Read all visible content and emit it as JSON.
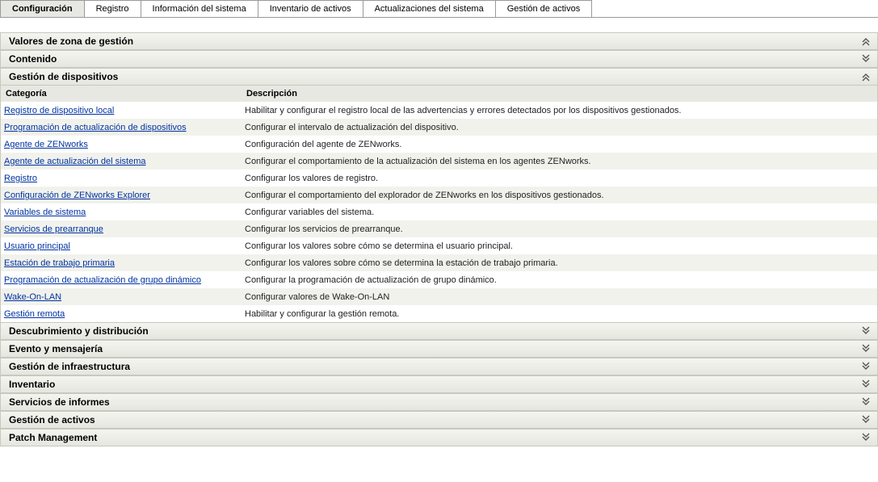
{
  "tabs": {
    "items": [
      {
        "label": "Configuración",
        "active": true
      },
      {
        "label": "Registro",
        "active": false
      },
      {
        "label": "Información del sistema",
        "active": false
      },
      {
        "label": "Inventario de activos",
        "active": false
      },
      {
        "label": "Actualizaciones del sistema",
        "active": false
      },
      {
        "label": "Gestión de activos",
        "active": false
      }
    ]
  },
  "main_panel": {
    "title": "Valores de zona de gestión",
    "section_before": {
      "title": "Contenido",
      "expanded": false
    },
    "expanded_section": {
      "title": "Gestión de dispositivos",
      "col_category": "Categoría",
      "col_description": "Descripción",
      "rows": [
        {
          "cat": "Registro de dispositivo local",
          "desc": "Habilitar y configurar el registro local de las advertencias y errores detectados por los dispositivos gestionados."
        },
        {
          "cat": "Programación de actualización de dispositivos",
          "desc": "Configurar el intervalo de actualización del dispositivo."
        },
        {
          "cat": "Agente de ZENworks",
          "desc": "Configuración del agente de ZENworks."
        },
        {
          "cat": "Agente de actualización del sistema",
          "desc": "Configurar el comportamiento de la actualización del sistema en los agentes ZENworks."
        },
        {
          "cat": "Registro",
          "desc": "Configurar los valores de registro."
        },
        {
          "cat": "Configuración de ZENworks Explorer",
          "desc": "Configurar el comportamiento del explorador de ZENworks en los dispositivos gestionados."
        },
        {
          "cat": "Variables de sistema",
          "desc": "Configurar variables del sistema."
        },
        {
          "cat": "Servicios de prearranque",
          "desc": "Configurar los servicios de prearranque."
        },
        {
          "cat": "Usuario principal",
          "desc": "Configurar los valores sobre cómo se determina el usuario principal."
        },
        {
          "cat": "Estación de trabajo primaria",
          "desc": "Configurar los valores sobre cómo se determina la estación de trabajo primaria."
        },
        {
          "cat": "Programación de actualización de grupo dinámico",
          "desc": "Configurar la programación de actualización de grupo dinámico."
        },
        {
          "cat": "Wake-On-LAN",
          "desc": "Configurar valores de Wake-On-LAN"
        },
        {
          "cat": "Gestión remota",
          "desc": "Habilitar y configurar la gestión remota."
        }
      ]
    },
    "sections_after": [
      {
        "title": "Descubrimiento y distribución"
      },
      {
        "title": "Evento y mensajería"
      },
      {
        "title": "Gestión de infraestructura"
      },
      {
        "title": "Inventario"
      },
      {
        "title": "Servicios de informes"
      },
      {
        "title": "Gestión de activos"
      },
      {
        "title": "Patch Management"
      }
    ]
  }
}
